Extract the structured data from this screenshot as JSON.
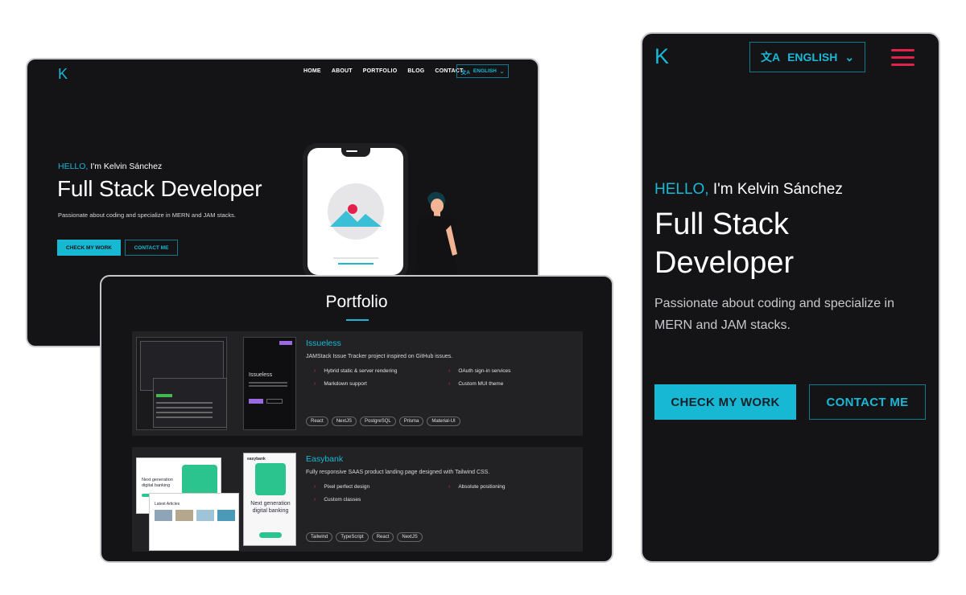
{
  "desktop": {
    "logo": "K",
    "nav": [
      "HOME",
      "ABOUT",
      "PORTFOLIO",
      "BLOG",
      "CONTACT"
    ],
    "language": "ENGLISH",
    "hello": "HELLO,",
    "name": " I'm Kelvin Sánchez",
    "title": "Full Stack Developer",
    "subtitle": "Passionate about coding and specialize in MERN and JAM stacks.",
    "primary_button": "CHECK MY WORK",
    "secondary_button": "CONTACT ME"
  },
  "portfolio": {
    "title": "Portfolio",
    "projects": [
      {
        "name": "Issueless",
        "description": "JAMStack Issue Tracker project inspired on GitHub issues.",
        "features": [
          "Hybrid static & server rendering",
          "OAuth sign-in services",
          "Markdown support",
          "Custom MUI theme"
        ],
        "tags": [
          "React",
          "NextJS",
          "PostgreSQL",
          "Prisma",
          "Material-UI"
        ],
        "preview_title": "Issueless"
      },
      {
        "name": "Easybank",
        "description": "Fully responsive SAAS product landing page designed with Tailwind CSS.",
        "features": [
          "Pixel perfect design",
          "Absolute positioning",
          "Custom classes"
        ],
        "tags": [
          "Tailwind",
          "TypeScript",
          "React",
          "NextJS"
        ],
        "preview_brand": "easybank",
        "preview_heading": "Next generation digital banking",
        "preview_desktop_heading": "Next generation digital banking",
        "preview_articles": "Latest Articles"
      }
    ]
  },
  "mobile": {
    "logo": "K",
    "language": "ENGLISH",
    "hello": "HELLO,",
    "name": " I'm Kelvin Sánchez",
    "title_line1": "Full Stack",
    "title_line2": "Developer",
    "subtitle": "Passionate about coding and specialize in MERN and JAM stacks.",
    "primary_button": "CHECK MY WORK",
    "secondary_button": "CONTACT ME"
  },
  "colors": {
    "accent": "#18b8d6",
    "menu": "#e2214d",
    "background": "#141416"
  },
  "icons": [
    "translate-icon",
    "chevron-down-icon",
    "hamburger-menu-icon",
    "chevron-right-icon"
  ]
}
